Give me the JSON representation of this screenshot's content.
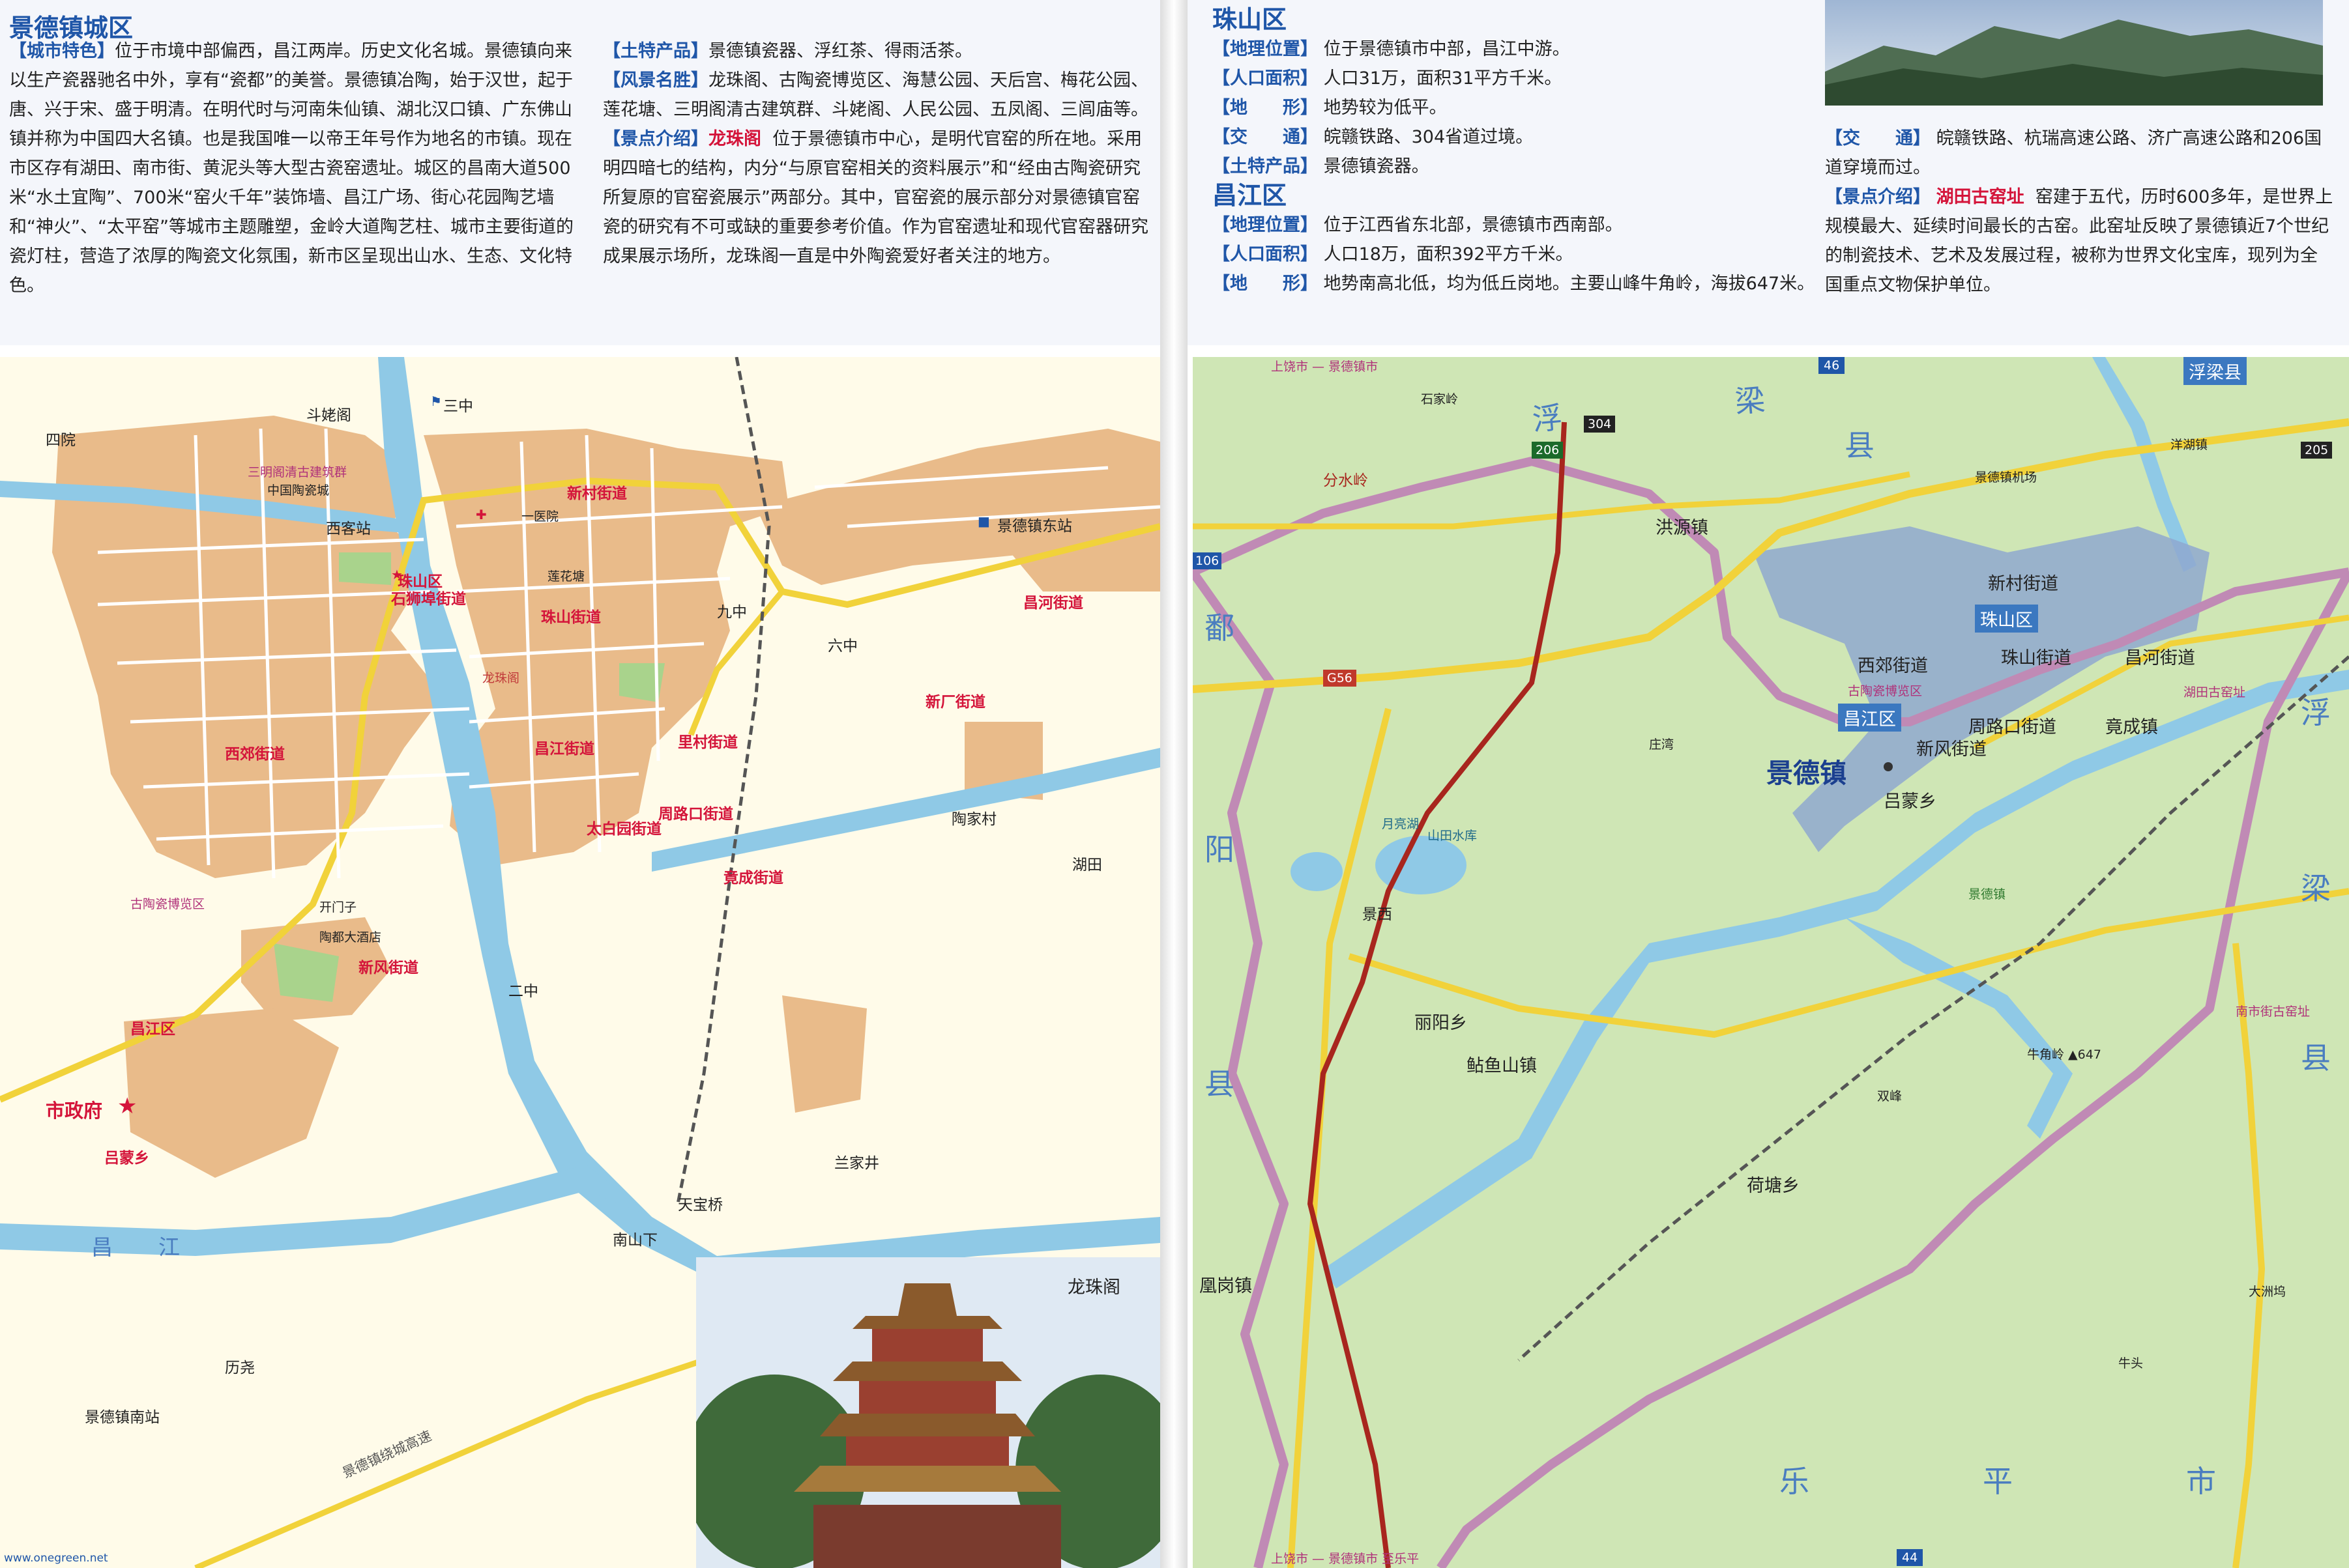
{
  "left_text": {
    "title": "景德镇城区",
    "col1": {
      "tag": "【城市特色】",
      "body": "位于市境中部偏西，昌江两岸。历史文化名城。景德镇向来以生产瓷器驰名中外，享有“瓷都”的美誉。景德镇冶陶，始于汉世，起于唐、兴于宋、盛于明清。在明代时与河南朱仙镇、湖北汉口镇、广东佛山镇并称为中国四大名镇。也是我国唯一以帝王年号作为地名的市镇。现在市区存有湖田、南市街、黄泥头等大型古瓷窑遗址。城区的昌南大道500米“水土宜陶”、700米“窑火千年”装饰墙、昌江广场、街心花园陶艺墙和“神火”、“太平窑”等城市主题雕塑，金岭大道陶艺柱、城市主要街道的瓷灯柱，营造了浓厚的陶瓷文化氛围，新市区呈现出山水、生态、文化特色。"
    },
    "col2": [
      {
        "tag": "【土特产品】",
        "body": "景德镇瓷器、浮红茶、得雨活茶。"
      },
      {
        "tag": "【风景名胜】",
        "body": "龙珠阁、古陶瓷博览区、海慧公园、天后宫、梅花公园、莲花塘、三明阁清古建筑群、斗姥阁、人民公园、五凤阁、三闾庙等。"
      },
      {
        "tag": "【景点介绍】",
        "highlight": "龙珠阁",
        "body": "位于景德镇市中心，是明代官窑的所在地。采用明四暗七的结构，内分“与原官窑相关的资料展示”和“经由古陶瓷研究所复原的官窑瓷展示”两部分。其中，官窑瓷的展示部分对景德镇官窑瓷的研究有不可或缺的重要参考价值。作为官窑遗址和现代官窑器研究成果展示场所，龙珠阁一直是中外陶瓷爱好者关注的地方。"
      }
    ]
  },
  "right_text": {
    "zhushan": {
      "title": "珠山区",
      "rows": [
        {
          "tag": "【地理位置】",
          "body": "位于景德镇市中部，昌江中游。"
        },
        {
          "tag": "【人口面积】",
          "body": "人口31万，面积31平方千米。"
        },
        {
          "tag": "【地　　形】",
          "body": "地势较为低平。"
        },
        {
          "tag": "【交　　通】",
          "body": "皖赣铁路、304省道过境。"
        },
        {
          "tag": "【土特产品】",
          "body": "景德镇瓷器。"
        }
      ]
    },
    "changjiang": {
      "title": "昌江区",
      "rows": [
        {
          "tag": "【地理位置】",
          "body": "位于江西省东北部，景德镇市西南部。"
        },
        {
          "tag": "【人口面积】",
          "body": "人口18万，面积392平方千米。"
        },
        {
          "tag": "【地　　形】",
          "body": "地势南高北低，均为低丘岗地。主要山峰牛角岭，海拔647米。"
        }
      ]
    },
    "col2": [
      {
        "tag": "【交　　通】",
        "body": "皖赣铁路、杭瑞高速公路、济广高速公路和206国道穿境而过。"
      },
      {
        "tag": "【景点介绍】",
        "highlight": "湖田古窑址",
        "body": "窑建于五代，历时600多年，是世界上规模最大、延续时间最长的古窑。此窑址反映了景德镇近7个世纪的制瓷技术、艺术及发展过程，被称为世界文化宝库，现列为全国重点文物保护单位。"
      }
    ]
  },
  "left_map": {
    "photo_caption": "龙珠阁",
    "labels": {
      "dou_mu_ge": "斗姥阁",
      "si_jiu": "四院",
      "sanming": "三明阁清古建筑群",
      "cidu": "中国陶瓷城",
      "xiguan": "西客站",
      "zhushanqu": "珠山区",
      "shiyan": "石狮埠街道",
      "xinchun": "新村街道",
      "changhe": "昌河街道",
      "xixi": "西郊街道",
      "zhushan_jd": "珠山街道",
      "longzhuge": "龙珠阁",
      "changjiang_jd": "昌江街道",
      "lihe": "里村街道",
      "xinchang": "新厂街道",
      "taibai": "太白园街道",
      "zhoulu": "周路口街道",
      "jingcheng": "竟成街道",
      "gutao": "古陶瓷博览区",
      "xinfeng": "新风街道",
      "changjiangqu": "昌江区",
      "zhengfu": "市政府",
      "lvmeng": "吕蒙乡",
      "jingdezhen_dong": "景德镇东站",
      "jingdezhen_nan": "景德镇南站",
      "lifang": "历尧",
      "tianbao": "天宝桥",
      "nanshan": "南山下",
      "lanjia": "兰家井",
      "taojiacun": "陶家村",
      "hutian": "湖田",
      "changjiang": "昌江",
      "jiutzhong": "九中",
      "liuzhong": "六中",
      "sanzhong": "三中",
      "erzhong": "二中",
      "kaimen": "开门子",
      "taodu": "陶都大酒店",
      "yihuayuan": "一医院",
      "liantang": "莲花塘",
      "jingdezhen_huanlu": "景德镇绕城高速"
    }
  },
  "right_map": {
    "labels": {
      "jingdezhen": "景德镇",
      "zhushanqu": "珠山区",
      "changjiangqu": "昌江区",
      "fuliangxian": "浮梁县",
      "xincun": "新村街道",
      "zhushan_jd": "珠山街道",
      "changhe": "昌河街道",
      "xijiao": "西郊街道",
      "gutao": "古陶瓷博览区",
      "xinfeng": "新风街道",
      "zhoulu": "周路口街道",
      "jingcheng": "竟成镇",
      "lvmeng": "吕蒙乡",
      "hutian": "湖田古窑址",
      "hongyuan": "洪源镇",
      "liyang": "丽阳乡",
      "yuyu": "鲇鱼山镇",
      "hetang": "荷塘乡",
      "jingxi": "景西",
      "yueliang": "月亮湖",
      "shantian": "山田水库",
      "niujiao": "牛角岭 ▲647",
      "fenggang": "凰岗镇",
      "jingdezhen_jiczhen": "景德镇",
      "nanshi": "南市街古窑址",
      "jingdezhen_airport": "景德镇机场",
      "fenshui": "分水岭",
      "fu_big": "浮　梁",
      "liang_big": "梁",
      "xian_big": "县",
      "po_big": "鄱",
      "yang_big": "阳",
      "xian2_big": "县",
      "leping_big": "乐　平　市",
      "fu2": "浮",
      "liang2": "梁",
      "xian3": "县",
      "shang_rao": "上饶市 — 景德镇市",
      "shang_rao2": "上饶市 — 景德镇市 至乐平",
      "g56": "G56",
      "s304": "304",
      "n206": "206",
      "s205": "205",
      "g46": "46",
      "g44": "44",
      "g106": "106",
      "shimiao": "石家岭",
      "yangfu": "洋湖镇",
      "zhuanglou": "庄湾",
      "shuangfeng": "双峰",
      "dazhou": "大洲坞",
      "niutou": "牛头"
    }
  },
  "watermark": "www.onegreen.net",
  "colors": {
    "urban": "#e9bb8a",
    "water": "#8fc9e6",
    "green": "#cfe6b5",
    "road_yellow": "#f1d23a",
    "text_blue": "#1f56a8",
    "boundary": "#c08ab5",
    "rail": "#555555",
    "district_fill": "#8fa8cf"
  }
}
